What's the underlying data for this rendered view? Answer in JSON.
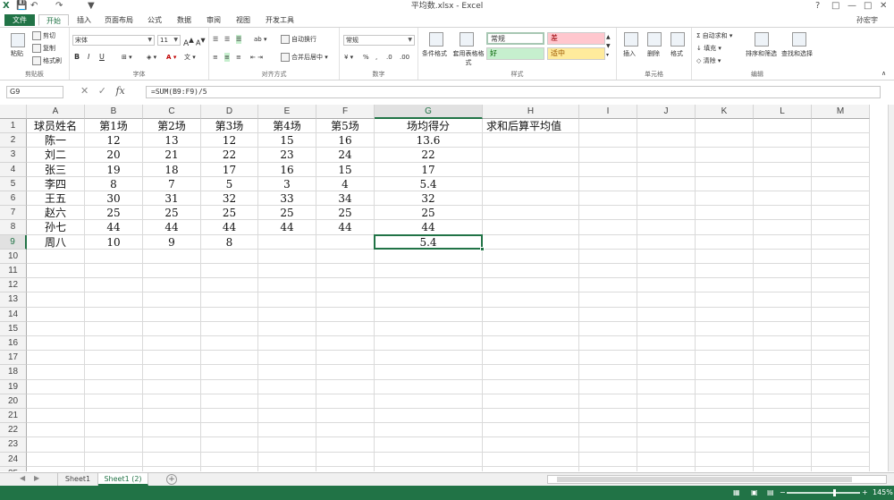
{
  "window": {
    "title": "平均数.xlsx - Excel",
    "controls": [
      "?",
      "□",
      "—",
      "□",
      "✕"
    ]
  },
  "tabs": [
    "文件",
    "开始",
    "插入",
    "页面布局",
    "公式",
    "数据",
    "审阅",
    "视图",
    "开发工具"
  ],
  "user": "孙宏宇",
  "ribbon": {
    "clipboard": {
      "paste": "粘贴",
      "cut": "剪切",
      "copy": "复制",
      "format_painter": "格式刷",
      "label": "剪贴板"
    },
    "font": {
      "name": "宋体",
      "size": "11",
      "bold": "B",
      "italic": "I",
      "underline": "U",
      "label": "字体"
    },
    "alignment": {
      "wrap": "自动换行",
      "merge": "合并后居中",
      "label": "对齐方式"
    },
    "number": {
      "format": "常规",
      "label": "数字"
    },
    "styles": {
      "conditional": "条件格式",
      "table": "套用表格格式",
      "normal": "常规",
      "bad": "差",
      "good": "好",
      "neutral": "适中",
      "label": "样式"
    },
    "cells": {
      "insert": "插入",
      "delete": "删除",
      "format": "格式",
      "label": "单元格"
    },
    "editing": {
      "autosum": "自动求和",
      "fill": "填充",
      "clear": "清除",
      "sort": "排序和筛选",
      "find": "查找和选择",
      "label": "编辑"
    }
  },
  "formula_bar": {
    "name_box": "G9",
    "formula": "=SUM(B9:F9)/5"
  },
  "columns": [
    "A",
    "B",
    "C",
    "D",
    "E",
    "F",
    "G",
    "H",
    "I",
    "J",
    "K",
    "L",
    "M"
  ],
  "rows": [
    [
      "球员姓名",
      "第1场",
      "第2场",
      "第3场",
      "第4场",
      "第5场",
      "场均得分",
      "求和后算平均值"
    ],
    [
      "陈一",
      "12",
      "13",
      "12",
      "15",
      "16",
      "13.6",
      ""
    ],
    [
      "刘二",
      "20",
      "21",
      "22",
      "23",
      "24",
      "22",
      ""
    ],
    [
      "张三",
      "19",
      "18",
      "17",
      "16",
      "15",
      "17",
      ""
    ],
    [
      "李四",
      "8",
      "7",
      "5",
      "3",
      "4",
      "5.4",
      ""
    ],
    [
      "王五",
      "30",
      "31",
      "32",
      "33",
      "34",
      "32",
      ""
    ],
    [
      "赵六",
      "25",
      "25",
      "25",
      "25",
      "25",
      "25",
      ""
    ],
    [
      "孙七",
      "44",
      "44",
      "44",
      "44",
      "44",
      "44",
      ""
    ],
    [
      "周八",
      "10",
      "9",
      "8",
      "",
      "",
      "5.4",
      ""
    ]
  ],
  "row_count": 25,
  "selected_cell": {
    "row": 9,
    "col": "G"
  },
  "sheets": [
    "Sheet1",
    "Sheet1 (2)"
  ],
  "active_sheet": 1,
  "status": {
    "zoom": "145%"
  },
  "colors": {
    "excel_green": "#217346",
    "bad_fill": "#ffc7ce",
    "good_fill": "#c6efce",
    "neutral_fill": "#ffeb9c"
  }
}
